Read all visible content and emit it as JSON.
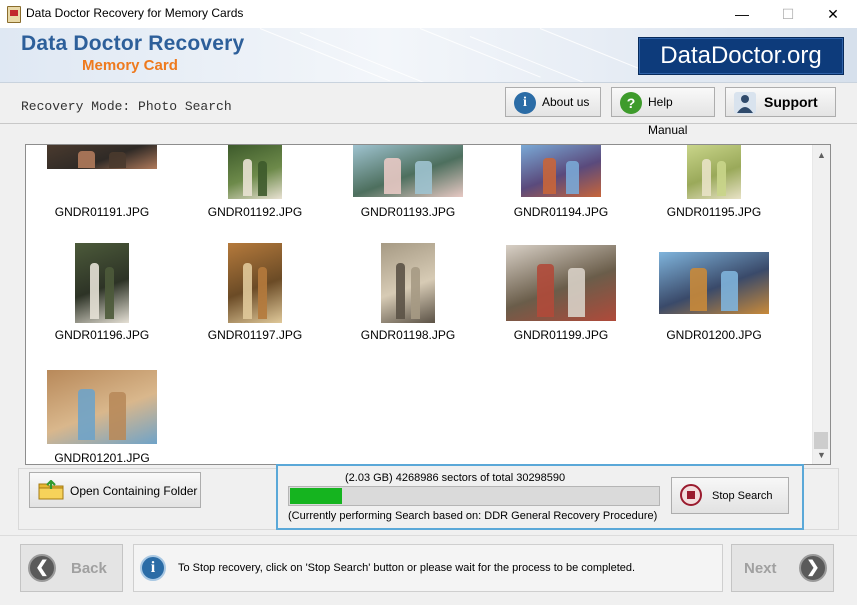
{
  "window": {
    "title": "Data Doctor Recovery for Memory Cards",
    "minimize": "—",
    "maximize": "☐",
    "close": "✕"
  },
  "banner": {
    "title": "Data Doctor Recovery",
    "subtitle": "Memory Card",
    "logo": "DataDoctor.org"
  },
  "toolbar": {
    "mode": "Recovery Mode: Photo Search",
    "about": "About us",
    "help": "Help Manual",
    "support": "Support"
  },
  "files": [
    {
      "name": "GNDR01191.JPG",
      "colors": [
        "#4a3a2e",
        "#b07a5b",
        "#2f2a26"
      ]
    },
    {
      "name": "GNDR01192.JPG",
      "colors": [
        "#3d5a2b",
        "#e9e2d3",
        "#6d8a4a"
      ]
    },
    {
      "name": "GNDR01193.JPG",
      "colors": [
        "#9fc3d0",
        "#e8c9c4",
        "#4d6f5e"
      ]
    },
    {
      "name": "GNDR01194.JPG",
      "colors": [
        "#7aa9d6",
        "#c8653a",
        "#5a4a7c"
      ]
    },
    {
      "name": "GNDR01195.JPG",
      "colors": [
        "#c9d58a",
        "#e8e2c6",
        "#9aa95a"
      ]
    },
    {
      "name": "GNDR01196.JPG",
      "colors": [
        "#4c5a3a",
        "#e6e1d6",
        "#2d3326"
      ]
    },
    {
      "name": "GNDR01197.JPG",
      "colors": [
        "#b57a3c",
        "#e0c99a",
        "#6b4b26"
      ]
    },
    {
      "name": "GNDR01198.JPG",
      "colors": [
        "#a69a84",
        "#5b5246",
        "#d7cbb5"
      ]
    },
    {
      "name": "GNDR01199.JPG",
      "colors": [
        "#d8d0c6",
        "#b04a3a",
        "#6a5d4a"
      ]
    },
    {
      "name": "GNDR01200.JPG",
      "colors": [
        "#7fb4dc",
        "#c98a3a",
        "#3a4a6a"
      ]
    },
    {
      "name": "GNDR01201.JPG",
      "colors": [
        "#b8895a",
        "#6fa3c8",
        "#d9b78c"
      ]
    }
  ],
  "actions": {
    "open_folder": "Open Containing Folder",
    "stop_search": "Stop Search"
  },
  "progress": {
    "sectors_text": "(2.03 GB) 4268986  sectors  of  total 30298590",
    "fraction": 0.1409,
    "performing_text": "(Currently performing Search based on:  DDR General Recovery Procedure)"
  },
  "footer": {
    "back": "Back",
    "next": "Next",
    "info": "To Stop recovery, click on 'Stop Search' button or please wait for the process to be completed."
  },
  "colors": {
    "accent": "#2d5f9a",
    "orange": "#ee7a1e",
    "logo_bg": "#0d3b7b",
    "progress": "#15b41f",
    "focus_border": "#5aa8d8"
  }
}
